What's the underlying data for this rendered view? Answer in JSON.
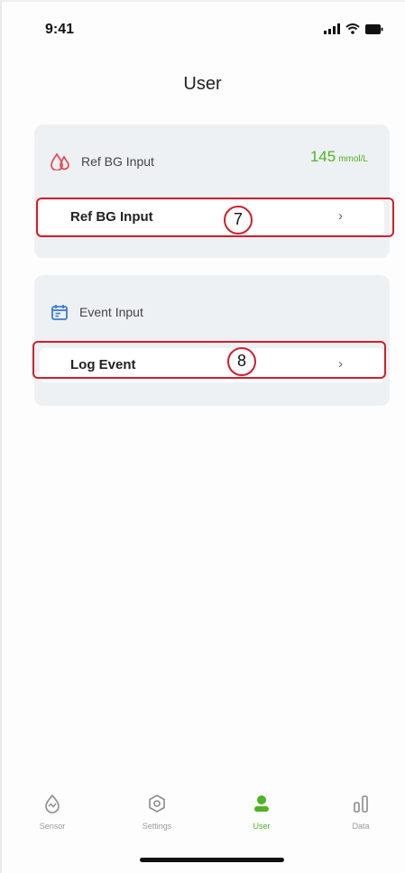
{
  "status_bar": {
    "time": "9:41"
  },
  "header": {
    "title": "User"
  },
  "ref_bg_card": {
    "header_label": "Ref BG Input",
    "value": "145",
    "unit": "mmol/L",
    "row_label": "Ref BG Input",
    "marker": "7"
  },
  "event_card": {
    "header_label": "Event Input",
    "row_label": "Log Event",
    "marker": "8"
  },
  "chevron": "›",
  "tabs": [
    {
      "label": "Sensor",
      "icon": "sensor-icon"
    },
    {
      "label": "Settings",
      "icon": "settings-icon"
    },
    {
      "label": "User",
      "icon": "user-icon",
      "active": true
    },
    {
      "label": "Data",
      "icon": "data-icon"
    }
  ],
  "colors": {
    "accent": "#4cb51f",
    "highlight": "#d01f2a",
    "blood_icon": "#e0505a",
    "calendar_icon": "#3a7bd5"
  }
}
